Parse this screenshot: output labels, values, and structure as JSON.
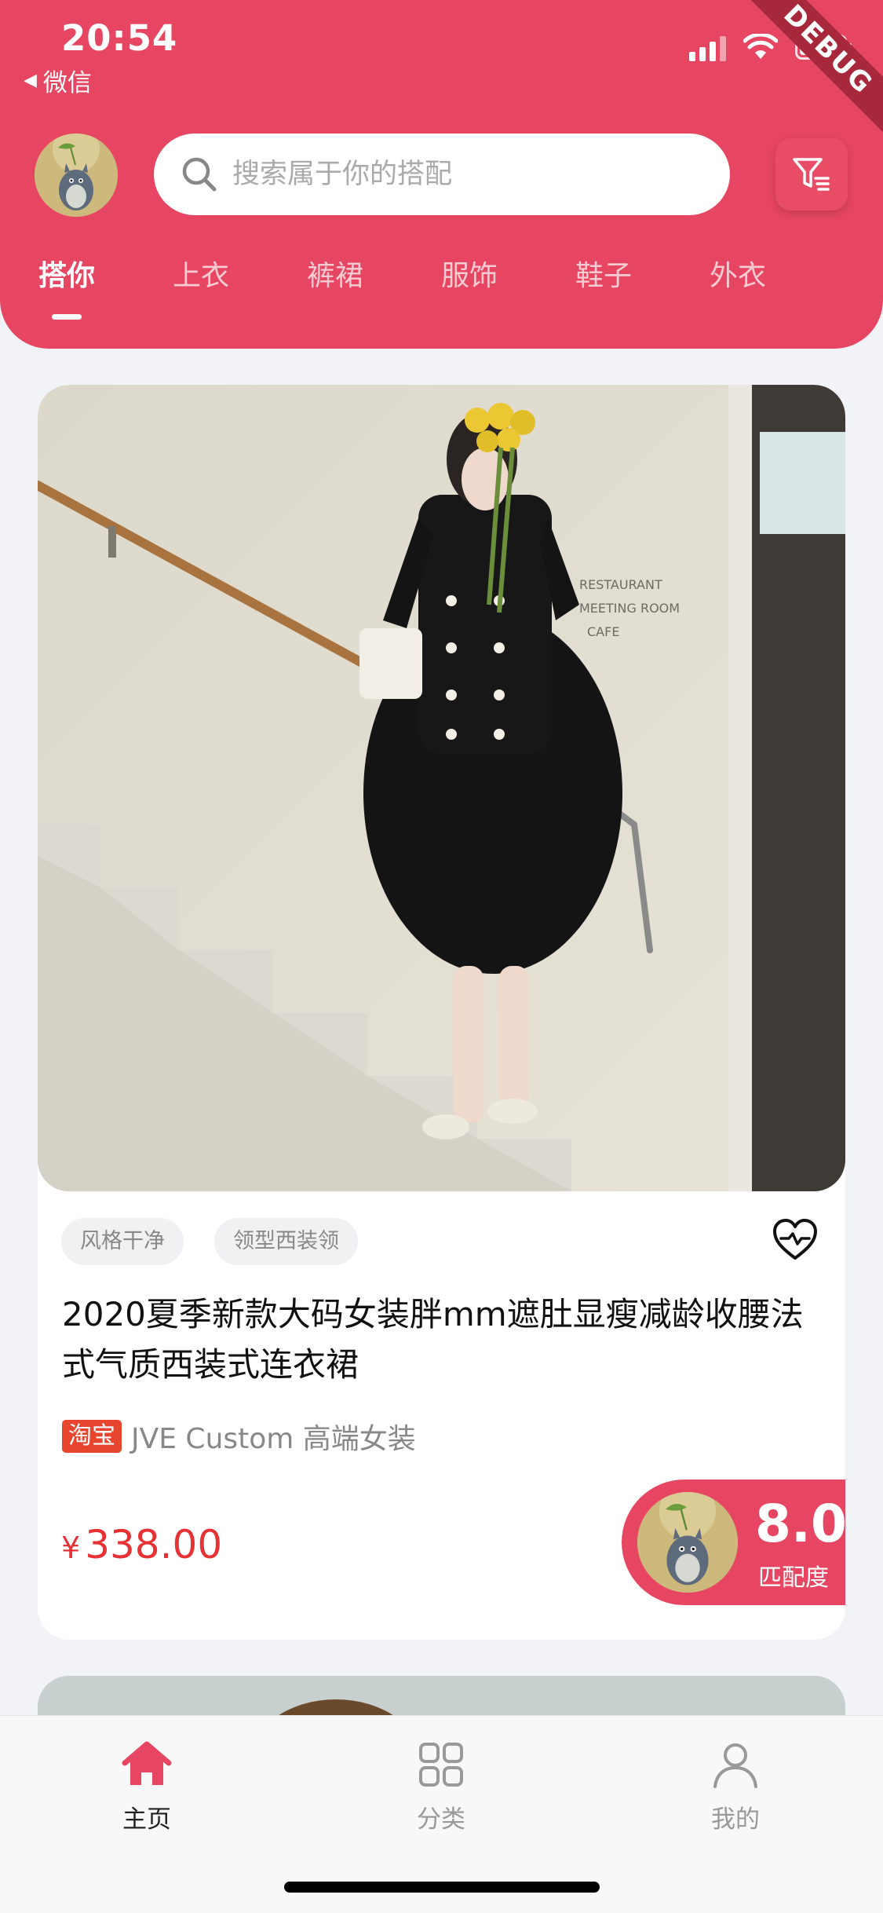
{
  "status_bar": {
    "time": "20:54",
    "back_app": "微信"
  },
  "debug_banner": "DEBUG",
  "search": {
    "placeholder": "搜索属于你的搭配"
  },
  "tabs": [
    {
      "label": "搭你",
      "active": true
    },
    {
      "label": "上衣",
      "active": false
    },
    {
      "label": "裤裙",
      "active": false
    },
    {
      "label": "服饰",
      "active": false
    },
    {
      "label": "鞋子",
      "active": false
    },
    {
      "label": "外衣",
      "active": false
    }
  ],
  "product": {
    "tags": [
      "风格干净",
      "领型西装领"
    ],
    "title": "2020夏季新款大码女装胖mm遮肚显瘦减龄收腰法式气质西装式连衣裙",
    "platform_badge": "淘宝",
    "shop_name": "JVE Custom 高端女装",
    "currency": "¥",
    "price": "338.00",
    "match_score": "8.0",
    "match_label": "匹配度"
  },
  "bottom_nav": [
    {
      "label": "主页",
      "icon": "home-icon",
      "active": true
    },
    {
      "label": "分类",
      "icon": "grid-icon",
      "active": false
    },
    {
      "label": "我的",
      "icon": "person-icon",
      "active": false
    }
  ],
  "colors": {
    "brand": "#e64661",
    "price": "#e63234",
    "badge": "#e8452f"
  }
}
